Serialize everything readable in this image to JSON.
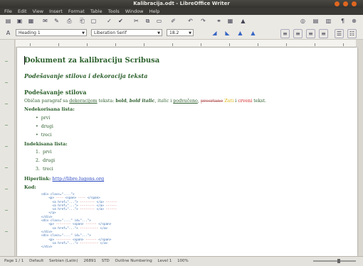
{
  "window": {
    "title": "Kalibracija.odt - LibreOffice Writer"
  },
  "menu": [
    "File",
    "Edit",
    "View",
    "Insert",
    "Format",
    "Table",
    "Tools",
    "Window",
    "Help"
  ],
  "toolbar": {
    "paragraph_style": "Heading 1",
    "font_name": "Liberation Serif",
    "font_size": "18.2"
  },
  "document": {
    "title": "Dokument za kalibraciju Scribusa",
    "subtitle": "Podešavanje stilova i dekoracija teksta",
    "section_heading": "Podešavanje stilova",
    "paragraph": {
      "intro": "Običan paragraf sa ",
      "emphasis": "dekoracijom",
      "middle": " teksta: ",
      "bold": "bold",
      "comma1": ", ",
      "bold_italic": "bold italic",
      "comma2": ", ",
      "italic": "italic",
      "and": " i ",
      "underlined": "podvučeno",
      "rest1": ", ",
      "strike": "precrtano",
      "rest2": " ",
      "color1": "Zuti",
      "rest3": " i ",
      "color2": "crveni",
      "end": " tekst."
    },
    "bullet_label": "Nedekorisana lista:",
    "bullets": [
      "prvi",
      "drugi",
      "treci"
    ],
    "numbered_label": "Indekisana lista:",
    "numbered": [
      "prvi",
      "drugi",
      "treci"
    ],
    "link_label": "Hiperlink: ",
    "link_text": "http://libre.lugons.org",
    "code_label": "Kod:"
  },
  "status": {
    "page": "Page 1 / 1",
    "style": "Default",
    "language": "Serbian (Latin)",
    "words": "26891",
    "mode": "STD",
    "section": "Outline Numbering",
    "level": "Level 1",
    "zoom": "100%"
  }
}
